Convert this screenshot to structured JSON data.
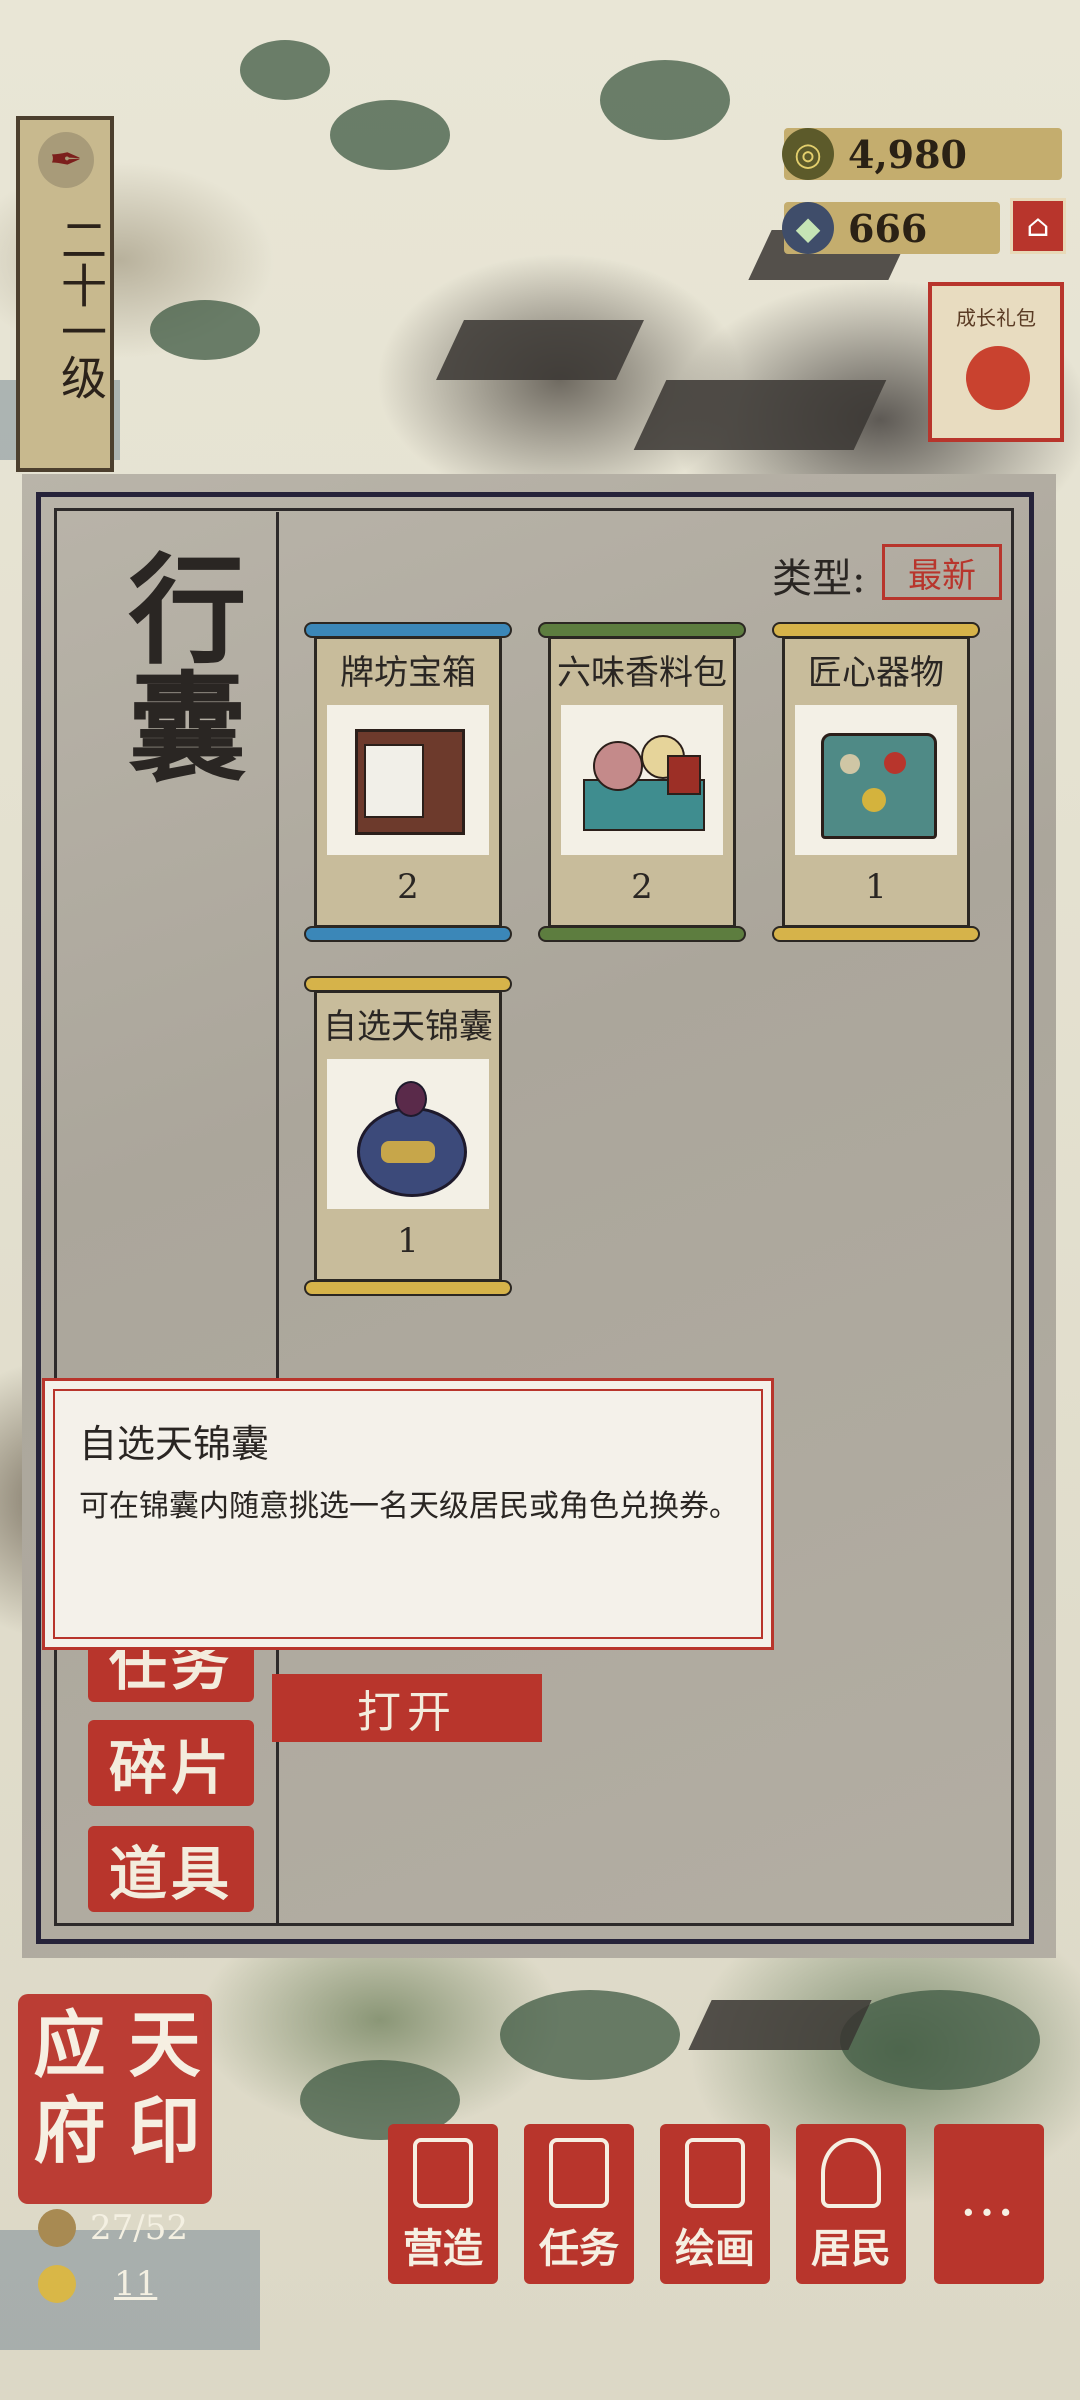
{
  "player": {
    "level_text": "二十一级"
  },
  "currency": {
    "coins": "4,980",
    "gems": "666"
  },
  "promo": {
    "label": "成长礼包"
  },
  "inventory": {
    "title": "行囊",
    "filter_label": "类型:",
    "filter_value": "最新",
    "items": [
      {
        "name": "牌坊宝箱",
        "count": "2",
        "icon": "chest-icon",
        "color": "#3b87b8"
      },
      {
        "name": "六味香料包",
        "count": "2",
        "icon": "spice-pack-icon",
        "color": "#5d7d3f"
      },
      {
        "name": "匠心器物",
        "count": "1",
        "icon": "craft-box-icon",
        "color": "#d6b34a"
      },
      {
        "name": "自选天锦囊",
        "count": "1",
        "icon": "pouch-icon",
        "color": "#d6b34a"
      }
    ],
    "side_tabs": [
      "任务",
      "碎片",
      "道具"
    ],
    "open_button": "打开"
  },
  "tooltip": {
    "name": "自选天锦囊",
    "description": "可在锦囊内随意挑选一名天级居民或角色兑换券。"
  },
  "city": {
    "name_chars": [
      "应",
      "天",
      "府",
      "印"
    ],
    "population": "27/52",
    "workers": "11"
  },
  "nav": [
    {
      "label": "营造",
      "icon": "build-icon"
    },
    {
      "label": "任务",
      "icon": "task-icon"
    },
    {
      "label": "绘画",
      "icon": "painting-icon"
    },
    {
      "label": "居民",
      "icon": "resident-icon"
    },
    {
      "label": "…",
      "icon": "more-icon"
    }
  ],
  "colors": {
    "accent_red": "#b8352c",
    "ink": "#2a2623",
    "paper": "#c8bc9b"
  }
}
